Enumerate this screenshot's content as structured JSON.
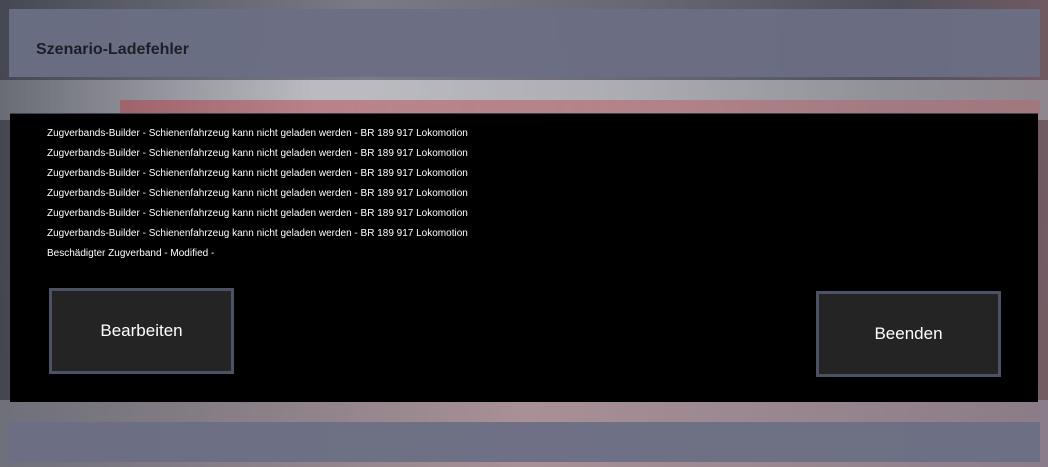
{
  "dialog": {
    "title": "Szenario-Ladefehler"
  },
  "messages": [
    "Zugverbands-Builder - Schienenfahrzeug kann nicht geladen werden - BR 189 917 Lokomotion",
    "Zugverbands-Builder - Schienenfahrzeug kann nicht geladen werden - BR 189 917 Lokomotion",
    "Zugverbands-Builder - Schienenfahrzeug kann nicht geladen werden - BR 189 917 Lokomotion",
    "Zugverbands-Builder - Schienenfahrzeug kann nicht geladen werden - BR 189 917 Lokomotion",
    "Zugverbands-Builder - Schienenfahrzeug kann nicht geladen werden - BR 189 917 Lokomotion",
    "Zugverbands-Builder - Schienenfahrzeug kann nicht geladen werden - BR 189 917 Lokomotion",
    "Beschädigter Zugverband - Modified -"
  ],
  "buttons": {
    "edit_label": "Bearbeiten",
    "quit_label": "Beenden"
  },
  "colors": {
    "title_bar": "#6b6f84",
    "panel": "#000000",
    "button_bg": "#242424",
    "button_border": "#4c5163"
  }
}
